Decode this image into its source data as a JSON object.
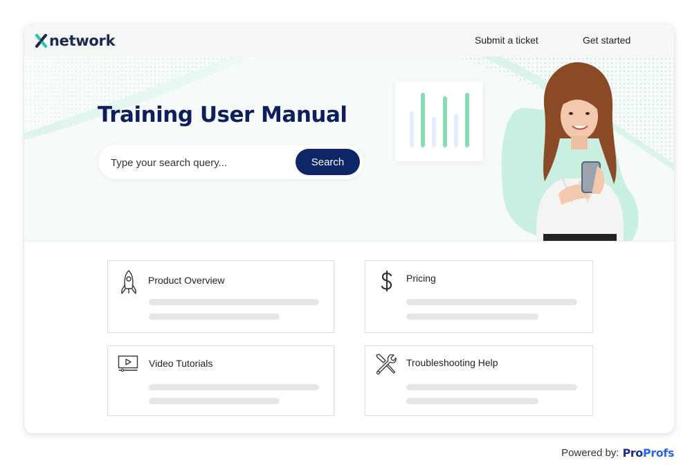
{
  "header": {
    "logo_text": "network",
    "nav": {
      "submit_ticket": "Submit a ticket",
      "get_started": "Get started"
    }
  },
  "hero": {
    "title": "Training User Manual",
    "search": {
      "placeholder": "Type your search query...",
      "button_label": "Search"
    }
  },
  "categories": [
    {
      "title": "Product Overview",
      "icon": "rocket-icon"
    },
    {
      "title": "Pricing",
      "icon": "dollar-icon"
    },
    {
      "title": "Video Tutorials",
      "icon": "video-player-icon"
    },
    {
      "title": "Troubleshooting Help",
      "icon": "tools-icon"
    }
  ],
  "footer": {
    "label": "Powered by:",
    "brand_part1": "Pro",
    "brand_part2": "Profs"
  },
  "colors": {
    "primary_navy": "#0e2566",
    "title_navy": "#0e1f5b",
    "accent_mint": "#86dcb8",
    "brand_dark": "#1e2f8a",
    "brand_blue": "#2a68e6"
  }
}
